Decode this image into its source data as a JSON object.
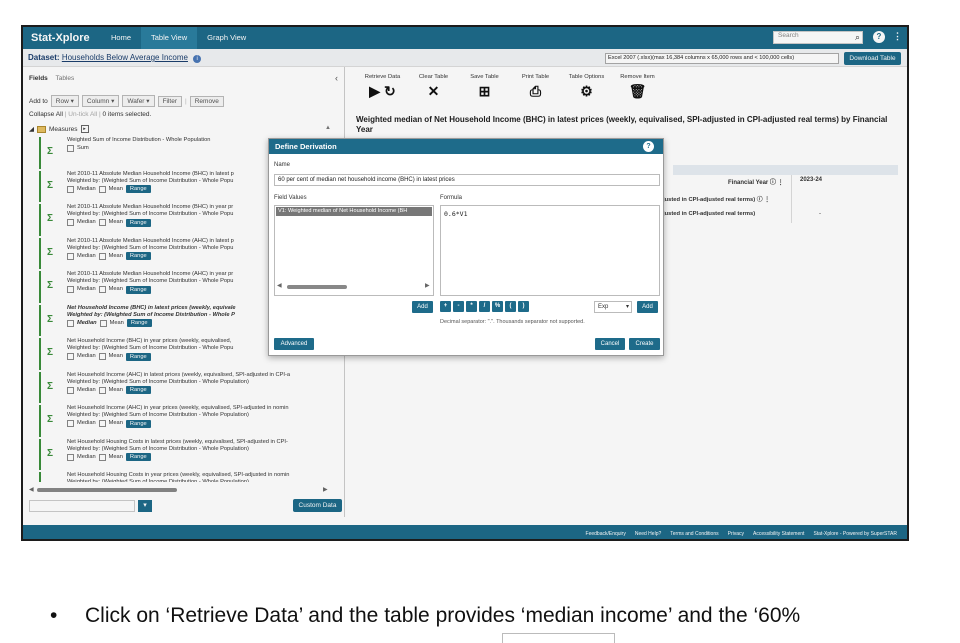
{
  "nav": {
    "brand": "Stat-Xplore",
    "tabs": [
      "Home",
      "Table View",
      "Graph View"
    ],
    "search_placeholder": "Search"
  },
  "dataset": {
    "label": "Dataset:",
    "name": "Households Below Average Income",
    "export_format": "Excel 2007 (.xlsx)(max 16,384 columns x 65,000 rows and < 100,000 cells)",
    "download_label": "Download Table"
  },
  "left_panel": {
    "tab_fields": "Fields",
    "tab_tables": "Tables",
    "add_to": "Add to",
    "row": "Row",
    "column": "Column",
    "wafer": "Wafer",
    "filter": "Filter",
    "remove": "Remove",
    "collapse_all": "Collapse All",
    "untick_all": "Un-tick All",
    "items_selected": "0 items selected.",
    "measures": "Measures",
    "custom_data": "Custom Data",
    "items": [
      {
        "title": "Weighted Sum of Income Distribution - Whole Population",
        "sub": "",
        "opts": [
          "Sum"
        ]
      },
      {
        "title": "Net 2010-11 Absolute Median Household Income (BHC) in latest p",
        "sub": "Weighted by: (Weighted Sum of Income Distribution - Whole Popu",
        "opts": [
          "Median",
          "Mean",
          "Range"
        ]
      },
      {
        "title": "Net 2010-11 Absolute Median Household Income (BHC) in year pr",
        "sub": "Weighted by: (Weighted Sum of Income Distribution - Whole Popu",
        "opts": [
          "Median",
          "Mean",
          "Range"
        ]
      },
      {
        "title": "Net 2010-11 Absolute Median Household Income (AHC) in latest p",
        "sub": "Weighted by: (Weighted Sum of Income Distribution - Whole Popu",
        "opts": [
          "Median",
          "Mean",
          "Range"
        ]
      },
      {
        "title": "Net 2010-11 Absolute Median Household Income (AHC) in year pr",
        "sub": "Weighted by: (Weighted Sum of Income Distribution - Whole Popu",
        "opts": [
          "Median",
          "Mean",
          "Range"
        ]
      },
      {
        "title": "Net Household Income (BHC) in latest prices (weekly, equivale",
        "sub": "Weighted by: (Weighted Sum of Income Distribution - Whole P",
        "opts": [
          "Median",
          "Mean",
          "Range"
        ],
        "bold": true
      },
      {
        "title": "Net Household Income (BHC) in year prices (weekly, equivalised,",
        "sub": "Weighted by: (Weighted Sum of Income Distribution - Whole Popu",
        "opts": [
          "Median",
          "Mean",
          "Range"
        ]
      },
      {
        "title": "Net Household Income (AHC) in latest prices (weekly, equivalised, SPI-adjusted in CPI-a",
        "sub": "Weighted by: (Weighted Sum of Income Distribution - Whole Population)",
        "opts": [
          "Median",
          "Mean",
          "Range"
        ]
      },
      {
        "title": "Net Household Income (AHC) in year prices (weekly, equivalised, SPI-adjusted in nomin",
        "sub": "Weighted by: (Weighted Sum of Income Distribution - Whole Population)",
        "opts": [
          "Median",
          "Mean",
          "Range"
        ]
      },
      {
        "title": "Net Household Housing Costs in latest prices (weekly, equivalised, SPI-adjusted in CPI-",
        "sub": "Weighted by: (Weighted Sum of Income Distribution - Whole Population)",
        "opts": [
          "Median",
          "Mean",
          "Range"
        ]
      },
      {
        "title": "Net Household Housing Costs in year prices (weekly, equivalised, SPI-adjusted in nomin",
        "sub": "Weighted by: (Weighted Sum of Income Distribution - Whole Population)",
        "opts": [
          "Median",
          "Mean",
          "Range"
        ]
      }
    ]
  },
  "toolbar": [
    {
      "label": "Retrieve Data",
      "icon": "play-refresh-icon",
      "glyph": "▶ ↻"
    },
    {
      "label": "Clear Table",
      "icon": "close-icon",
      "glyph": "✕"
    },
    {
      "label": "Save Table",
      "icon": "save-table-icon",
      "glyph": "⊞"
    },
    {
      "label": "Print Table",
      "icon": "print-icon",
      "glyph": "⎙"
    },
    {
      "label": "Table Options",
      "icon": "gear-icon",
      "glyph": "⚙"
    },
    {
      "label": "Remove Item",
      "icon": "trash-icon",
      "glyph": "🗑"
    }
  ],
  "table": {
    "title": "Weighted median of Net Household Income (BHC) in latest prices (weekly, equivalised, SPI-adjusted in CPI-adjusted real terms) by Financial Year",
    "col_header_label": "Financial Year",
    "col_header_value": "2023-24",
    "row1": "justed in CPI-adjusted real terms)",
    "row2": "justed in CPI-adjusted real terms)",
    "row2_value": "-"
  },
  "dialog": {
    "title": "Define Derivation",
    "name_label": "Name",
    "name_value": "60 per cent of median net household income (BHC) in latest prices",
    "field_values_label": "Field Values",
    "field_value_item": "V1: Weighted median of Net Household Income (BH",
    "formula_label": "Formula",
    "formula_value": "0.6*V1",
    "add_label": "Add",
    "operators": [
      "+",
      "-",
      "*",
      "/",
      "%",
      "(",
      ")"
    ],
    "function_selected": "Exp",
    "decimal_note": "Decimal separator: \".\". Thousands separator not supported.",
    "advanced_label": "Advanced",
    "cancel_label": "Cancel",
    "create_label": "Create"
  },
  "footer": [
    "Feedback/Enquiry",
    "Need Help?",
    "Terms and Conditions",
    "Privacy",
    "Accessibility Statement",
    "Stat-Xplore - Powered by SuperSTAR"
  ],
  "caption": {
    "bullet": "•",
    "text": "Click on ‘Retrieve Data’ and the table provides ‘median income’ and the ‘60%"
  }
}
